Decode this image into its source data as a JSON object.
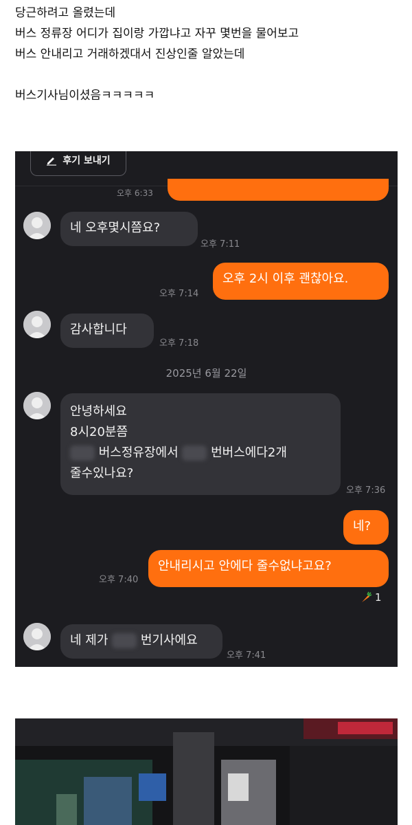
{
  "post": {
    "lines": [
      "당근하려고 올렸는데",
      "버스 정류장 어디가 집이랑 가깝냐고 자꾸 몇번을 물어보고",
      "버스 안내리고 거래하겠대서 진상인줄 알았는데",
      "",
      "버스기사님이셨음ㅋㅋㅋㅋㅋ"
    ]
  },
  "chat": {
    "review_button": "후기 보내기",
    "partial_time": "오후 6:33",
    "messages": [
      {
        "text": "네 오후몇시쯤요?",
        "time": "오후 7:11"
      },
      {
        "text": "오후 2시 이후 괜찮아요.",
        "time": "오후 7:14"
      },
      {
        "text": "감사합니다",
        "time": "오후 7:18"
      },
      {
        "line1": "안녕하세요",
        "line2": "8시20분쯤",
        "line3a": "버스정유장에서",
        "line3b": "번버스에다2개",
        "line4": "줄수있나요?",
        "time": "오후 7:36"
      },
      {
        "text": "네?"
      },
      {
        "text": "안내리시고 안에다 줄수없냐고요?",
        "time": "오후 7:40",
        "reaction_count": "1"
      },
      {
        "text_a": "네 제가",
        "text_b": "번기사에요",
        "time": "오후 7:41"
      }
    ],
    "date_separator": "2025년 6월 22일",
    "colors": {
      "background": "#1c1c20",
      "incoming": "#333338",
      "outgoing": "#ff6f0f"
    }
  }
}
